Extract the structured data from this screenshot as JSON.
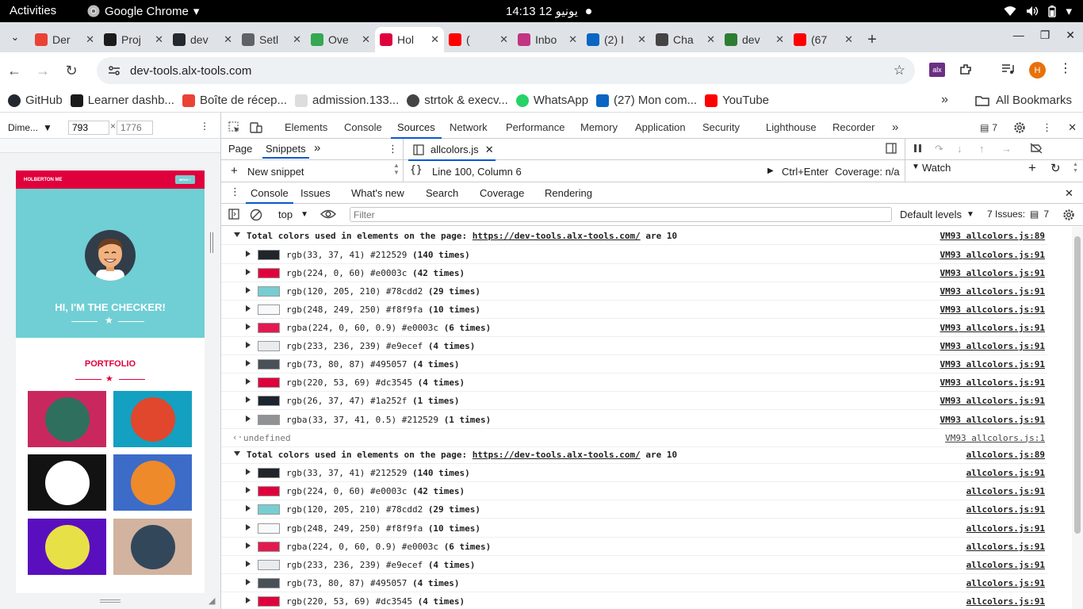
{
  "topbar": {
    "activities": "Activities",
    "app_name": "Google Chrome",
    "clock": "14:13  يونيو 12"
  },
  "tabs": [
    {
      "label": "Der",
      "fav_color": "#ea4335"
    },
    {
      "label": "Proj",
      "fav_color": "#1b1b1b"
    },
    {
      "label": "dev",
      "fav_color": "#24292f"
    },
    {
      "label": "Setl",
      "fav_color": "#5f6368"
    },
    {
      "label": "Ove",
      "fav_color": "#34a853"
    },
    {
      "label": "Hol",
      "fav_color": "#e0003c"
    },
    {
      "label": "(",
      "fav_color": "#ff0000"
    },
    {
      "label": "Inbo",
      "fav_color": "#c13584"
    },
    {
      "label": "(2) I",
      "fav_color": "#0a66c2"
    },
    {
      "label": "Cha",
      "fav_color": "#444444"
    },
    {
      "label": "dev",
      "fav_color": "#2e7d32"
    },
    {
      "label": "(67",
      "fav_color": "#ff0000"
    }
  ],
  "omnibox": {
    "url": "dev-tools.alx-tools.com"
  },
  "profile": {
    "initial": "H"
  },
  "bookmarks": [
    {
      "label": "GitHub",
      "icon": "github-icon"
    },
    {
      "label": "Learner dashb...",
      "icon": "alx-icon"
    },
    {
      "label": "Boîte de récep...",
      "icon": "gmail-icon"
    },
    {
      "label": "admission.133...",
      "icon": "site-icon"
    },
    {
      "label": "strtok & execv...",
      "icon": "openai-icon"
    },
    {
      "label": "WhatsApp",
      "icon": "whatsapp-icon"
    },
    {
      "label": "(27) Mon com...",
      "icon": "linkedin-icon"
    },
    {
      "label": "YouTube",
      "icon": "youtube-icon"
    }
  ],
  "all_bookmarks": "All Bookmarks",
  "device": {
    "preset": "Dime...",
    "width": "793",
    "height": "1776"
  },
  "site": {
    "brand": "HOLBERTON ME",
    "menu": "MENU ≡",
    "hero_title": "HI, I'M THE CHECKER!",
    "portfolio_title": "PORTFOLIO",
    "tiles": [
      {
        "bg": "#c9285f",
        "circle": "#2f6f5e"
      },
      {
        "bg": "#14a0c0",
        "circle": "#e0472d"
      },
      {
        "bg": "#121212",
        "circle": "#ffffff"
      },
      {
        "bg": "#3d6bc8",
        "circle": "#ee8a2a"
      },
      {
        "bg": "#5a0fbf",
        "circle": "#e8e047"
      },
      {
        "bg": "#d2b39f",
        "circle": "#33475b"
      }
    ]
  },
  "devtools": {
    "main_tabs": [
      "Elements",
      "Console",
      "Sources",
      "Network",
      "Performance",
      "Memory",
      "Application",
      "Security",
      "Lighthouse",
      "Recorder"
    ],
    "active_main": "Sources",
    "issues_count": "7",
    "sources_nav": [
      "Page",
      "Snippets"
    ],
    "open_file": "allcolors.js",
    "new_snippet": "New snippet",
    "cursor_pos": "Line 100, Column 6",
    "run_shortcut": "Ctrl+Enter",
    "coverage": "Coverage: n/a",
    "watch": "Watch",
    "drawer_tabs": [
      "Console",
      "Issues",
      "What's new",
      "Search",
      "Coverage",
      "Rendering"
    ],
    "context": "top",
    "filter_placeholder": "Filter",
    "levels": "Default levels",
    "issues_label": "7 Issues:",
    "issues_badge": "7"
  },
  "console": {
    "group1": {
      "head": "Total colors used in elements on the page: ",
      "link": "https://dev-tools.alx-tools.com/",
      "tail": " are 10",
      "src": "VM93 allcolors.js:89",
      "rows": [
        {
          "text": "rgb(33, 37, 41) #212529 ",
          "count": "(140 times)",
          "color": "#212529",
          "src": "VM93 allcolors.js:91"
        },
        {
          "text": "rgb(224, 0, 60) #e0003c ",
          "count": "(42 times)",
          "color": "#e0003c",
          "src": "VM93 allcolors.js:91"
        },
        {
          "text": "rgb(120, 205, 210) #78cdd2 ",
          "count": "(29 times)",
          "color": "#78cdd2",
          "src": "VM93 allcolors.js:91"
        },
        {
          "text": "rgb(248, 249, 250) #f8f9fa ",
          "count": "(10 times)",
          "color": "#f8f9fa",
          "src": "VM93 allcolors.js:91"
        },
        {
          "text": "rgba(224, 0, 60, 0.9) #e0003c ",
          "count": "(6 times)",
          "color": "#e31a4f",
          "src": "VM93 allcolors.js:91"
        },
        {
          "text": "rgb(233, 236, 239) #e9ecef ",
          "count": "(4 times)",
          "color": "#e9ecef",
          "src": "VM93 allcolors.js:91"
        },
        {
          "text": "rgb(73, 80, 87) #495057 ",
          "count": "(4 times)",
          "color": "#495057",
          "src": "VM93 allcolors.js:91"
        },
        {
          "text": "rgb(220, 53, 69) #dc3545 ",
          "count": "(4 times)",
          "color": "#e0003c",
          "src": "VM93 allcolors.js:91"
        },
        {
          "text": "rgb(26, 37, 47) #1a252f ",
          "count": "(1 times)",
          "color": "#1a252f",
          "src": "VM93 allcolors.js:91"
        },
        {
          "text": "rgba(33, 37, 41, 0.5) #212529 ",
          "count": "(1 times)",
          "color": "#909294",
          "src": "VM93 allcolors.js:91"
        }
      ]
    },
    "undefined_line": {
      "text": "undefined",
      "src": "VM93 allcolors.js:1"
    },
    "group2": {
      "head": "Total colors used in elements on the page: ",
      "link": "https://dev-tools.alx-tools.com/",
      "tail": " are 10",
      "src": "allcolors.js:89",
      "rows": [
        {
          "text": "rgb(33, 37, 41) #212529 ",
          "count": "(140 times)",
          "color": "#212529",
          "src": "allcolors.js:91"
        },
        {
          "text": "rgb(224, 0, 60) #e0003c ",
          "count": "(42 times)",
          "color": "#e0003c",
          "src": "allcolors.js:91"
        },
        {
          "text": "rgb(120, 205, 210) #78cdd2 ",
          "count": "(29 times)",
          "color": "#78cdd2",
          "src": "allcolors.js:91"
        },
        {
          "text": "rgb(248, 249, 250) #f8f9fa ",
          "count": "(10 times)",
          "color": "#f8f9fa",
          "src": "allcolors.js:91"
        },
        {
          "text": "rgba(224, 0, 60, 0.9) #e0003c ",
          "count": "(6 times)",
          "color": "#e31a4f",
          "src": "allcolors.js:91"
        },
        {
          "text": "rgb(233, 236, 239) #e9ecef ",
          "count": "(4 times)",
          "color": "#e9ecef",
          "src": "allcolors.js:91"
        },
        {
          "text": "rgb(73, 80, 87) #495057 ",
          "count": "(4 times)",
          "color": "#495057",
          "src": "allcolors.js:91"
        },
        {
          "text": "rgb(220, 53, 69) #dc3545 ",
          "count": "(4 times)",
          "color": "#e0003c",
          "src": "allcolors.js:91"
        }
      ]
    }
  }
}
